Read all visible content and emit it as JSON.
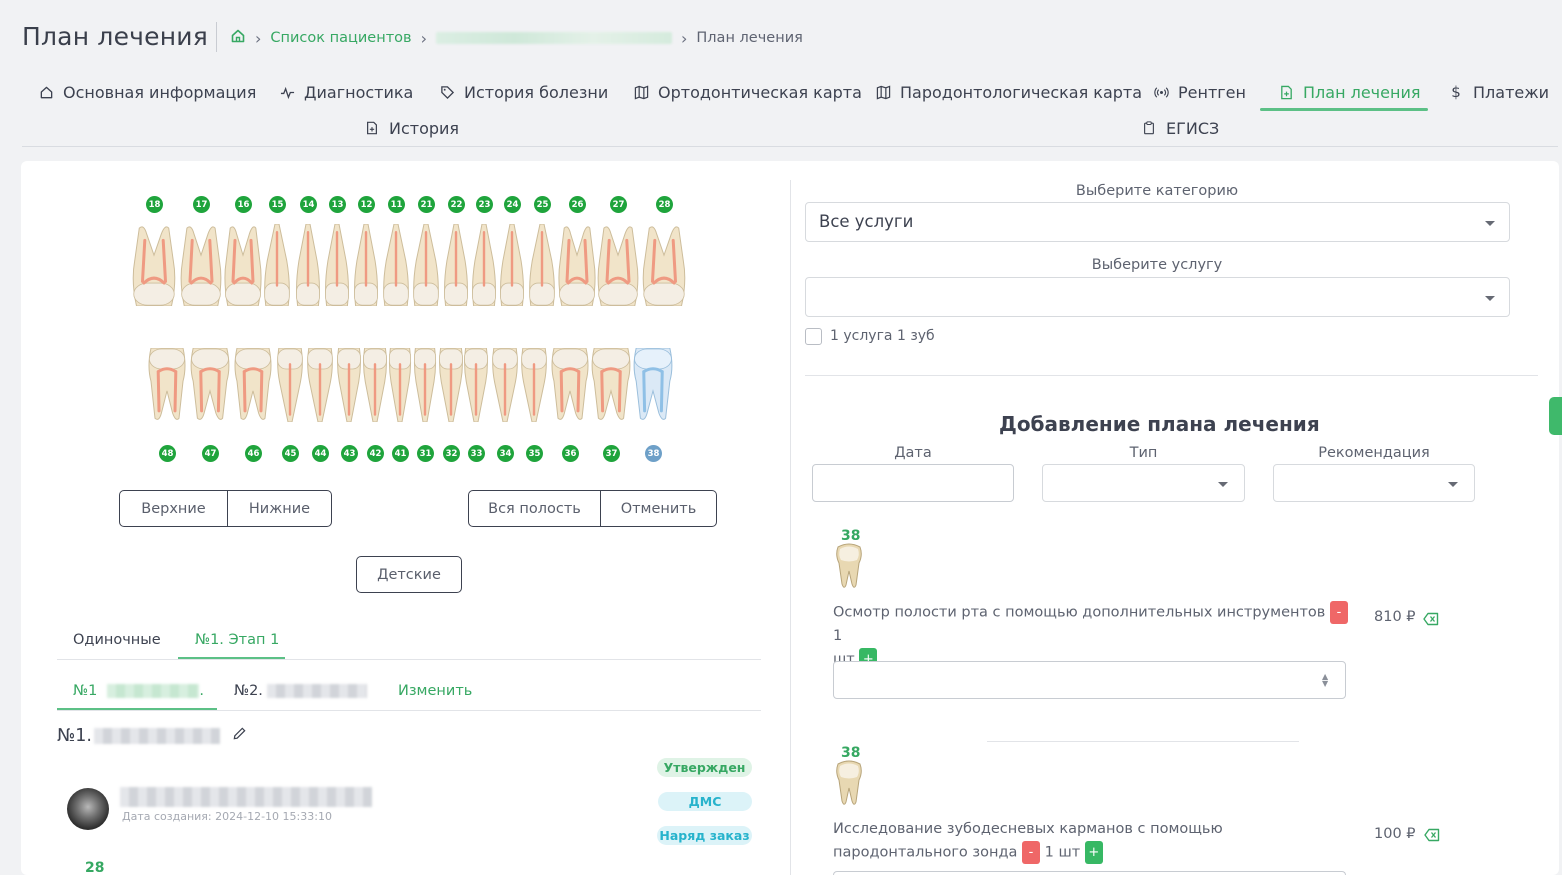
{
  "header": {
    "title": "План лечения",
    "breadcrumb": {
      "patients_list": "Список пациентов",
      "current": "План лечения"
    }
  },
  "tabs": [
    {
      "label": "Основная информация",
      "icon": "home-icon"
    },
    {
      "label": "Диагностика",
      "icon": "pulse-icon"
    },
    {
      "label": "История болезни",
      "icon": "tag-icon"
    },
    {
      "label": "Ортодонтическая карта",
      "icon": "map-icon"
    },
    {
      "label": "Пародонтологическая карта",
      "icon": "map-icon"
    },
    {
      "label": "Рентген",
      "icon": "radio-icon"
    },
    {
      "label": "План лечения",
      "icon": "file-plus-icon",
      "active": true
    },
    {
      "label": "Платежи",
      "icon": "dollar-icon"
    },
    {
      "label": "История",
      "icon": "file-plus-icon"
    },
    {
      "label": "ЕГИСЗ",
      "icon": "clipboard-icon"
    }
  ],
  "teeth": {
    "upper": [
      "18",
      "17",
      "16",
      "15",
      "14",
      "13",
      "12",
      "11",
      "21",
      "22",
      "23",
      "24",
      "25",
      "26",
      "27",
      "28"
    ],
    "lower": [
      "48",
      "47",
      "46",
      "45",
      "44",
      "43",
      "42",
      "41",
      "31",
      "32",
      "33",
      "34",
      "35",
      "36",
      "37",
      "38"
    ],
    "selected": "38"
  },
  "buttons": {
    "upper": "Верхние",
    "lower": "Нижние",
    "whole": "Вся полость",
    "cancel": "Отменить",
    "kids": "Детские"
  },
  "plan_tabs": {
    "single": "Одиночные",
    "stage": "№1. Этап 1"
  },
  "sub_tabs": {
    "first": "№1",
    "second": "№2.",
    "edit": "Изменить"
  },
  "plan": {
    "title_prefix": "№1.",
    "created": "Дата создания: 2024-12-10 15:33:10",
    "badges": {
      "approved": "Утвержден",
      "dms": "ДМС",
      "order": "Наряд заказ"
    },
    "tooth_ref": "28"
  },
  "right": {
    "category_label": "Выберите категорию",
    "category_value": "Все услуги",
    "service_label": "Выберите услугу",
    "service_value": "",
    "one_service_label": "1 услуга 1 зуб",
    "add_title": "Добавление плана лечения",
    "date_label": "Дата",
    "type_label": "Тип",
    "recommend_label": "Рекомендация",
    "services": [
      {
        "tooth": "38",
        "name": "Осмотр полости рта с помощью дополнительных инструментов",
        "qty_pre": "1",
        "unit": "шт",
        "price": "810 ₽"
      },
      {
        "tooth": "38",
        "name": "Исследование зубодесневых карманов с помощью",
        "name2": "пародонтального зонда",
        "qty": "1 шт",
        "price": "100 ₽"
      }
    ]
  },
  "colors": {
    "accent": "#37a863",
    "tooth_badge": "#1fa43c",
    "selected_badge": "#6ea0c8",
    "minus": "#ef6767",
    "plus": "#37b864"
  }
}
